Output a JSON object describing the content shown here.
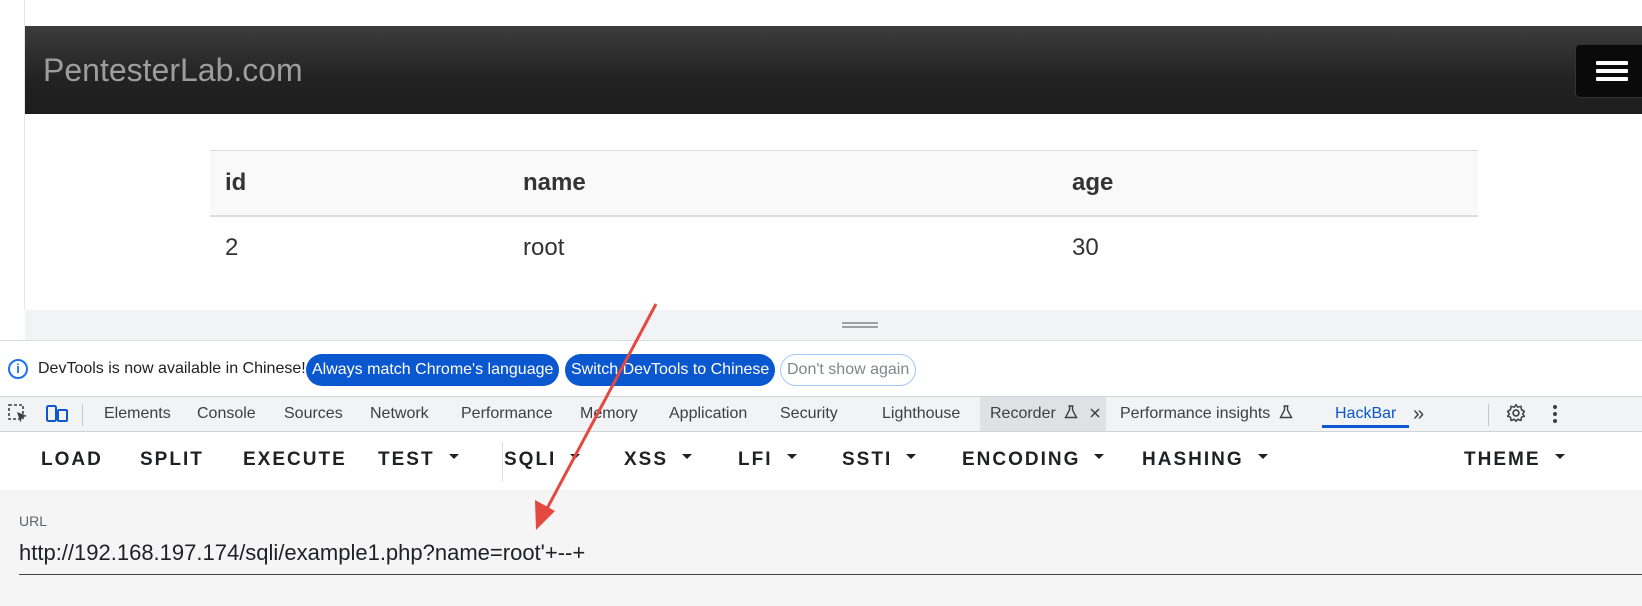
{
  "site": {
    "brand": "PentesterLab.com"
  },
  "table": {
    "headers": [
      "id",
      "name",
      "age"
    ],
    "rows": [
      [
        "2",
        "root",
        "30"
      ]
    ]
  },
  "devtools": {
    "infobar": {
      "text": "DevTools is now available in Chinese!",
      "match_language": "Always match Chrome's language",
      "switch_language": "Switch DevTools to Chinese",
      "dont_show": "Don't show again"
    },
    "tabs": {
      "elements": "Elements",
      "console": "Console",
      "sources": "Sources",
      "network": "Network",
      "performance": "Performance",
      "memory": "Memory",
      "application": "Application",
      "security": "Security",
      "lighthouse": "Lighthouse",
      "recorder": "Recorder",
      "performance_insights": "Performance insights",
      "hackbar": "HackBar",
      "more": "»"
    }
  },
  "hackbar": {
    "buttons": {
      "load": "LOAD",
      "split": "SPLIT",
      "execute": "EXECUTE",
      "test": "TEST",
      "sqli": "SQLI",
      "xss": "XSS",
      "lfi": "LFI",
      "ssti": "SSTI",
      "encoding": "ENCODING",
      "hashing": "HASHING",
      "theme": "THEME"
    },
    "url_label": "URL",
    "url_value": "http://192.168.197.174/sqli/example1.php?name=root'+--+"
  },
  "colors": {
    "accent": "#0b57d0",
    "annotation_arrow": "#e5483f",
    "navbar": "#222222"
  }
}
